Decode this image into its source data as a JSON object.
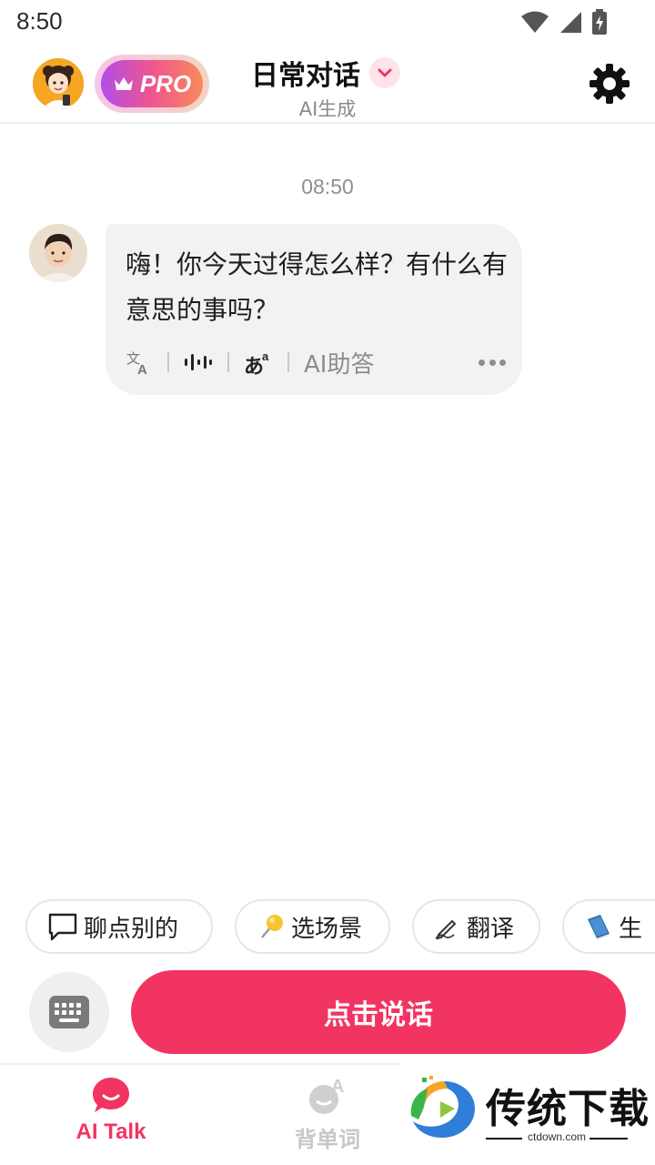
{
  "status_bar": {
    "time": "8:50"
  },
  "header": {
    "pro_label": "PRO",
    "title": "日常对话",
    "subtitle": "AI生成"
  },
  "chat": {
    "timestamp": "08:50",
    "message": "嗨！你今天过得怎么样？有什么有意思的事吗？",
    "tools": {
      "translate_icon": "translate-icon",
      "audio_icon": "waveform-icon",
      "phonetic_icon": "phonetic-icon",
      "assist_label": "AI助答",
      "more_icon": "more-icon"
    }
  },
  "chips": [
    {
      "icon": "chat-bubble-icon",
      "label": "聊点别的"
    },
    {
      "icon": "pin-icon",
      "label": "选场景"
    },
    {
      "icon": "pen-icon",
      "label": "翻译"
    },
    {
      "icon": "book-icon",
      "label": "生"
    }
  ],
  "input": {
    "talk_label": "点击说话",
    "keyboard_icon": "keyboard-icon"
  },
  "nav": {
    "items": [
      {
        "label": "AI Talk",
        "icon": "ai-talk-icon",
        "active": true
      },
      {
        "label": "背单词",
        "icon": "vocab-icon",
        "active": false
      }
    ]
  },
  "watermark": {
    "text": "传统下载",
    "url": "ctdown.com"
  },
  "colors": {
    "accent": "#f23462",
    "inactive": "#c8c8c8",
    "bubble": "#f2f2f2"
  }
}
